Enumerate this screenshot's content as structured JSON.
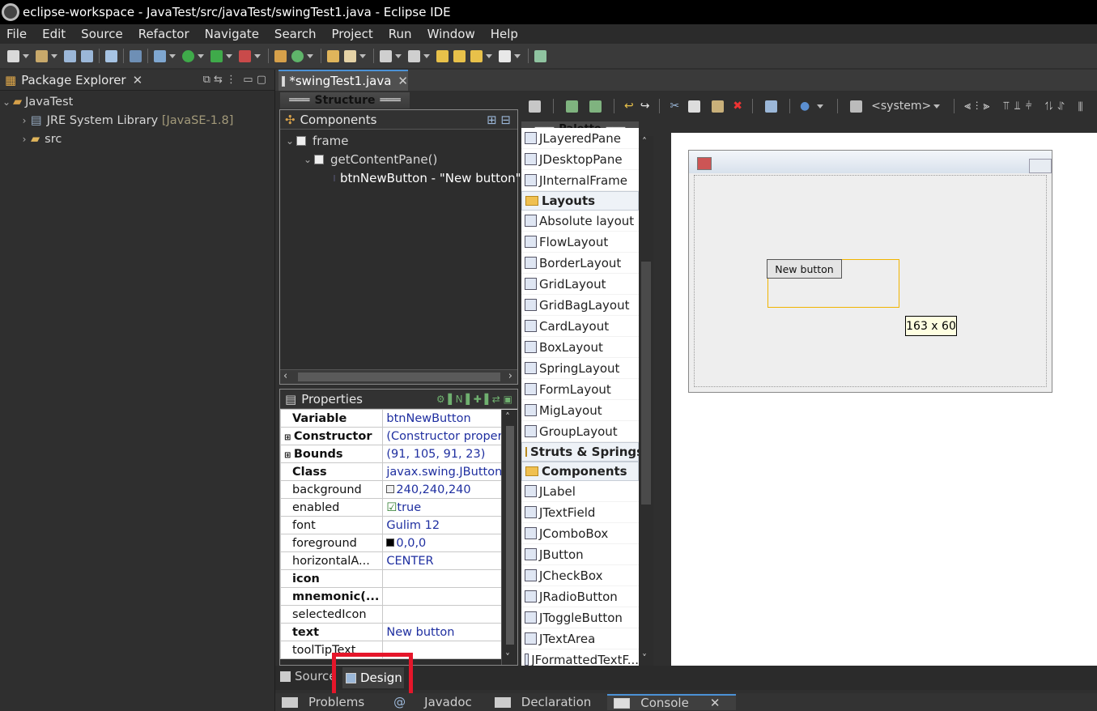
{
  "window": {
    "title": "eclipse-workspace - JavaTest/src/javaTest/swingTest1.java - Eclipse IDE"
  },
  "menu": [
    "File",
    "Edit",
    "Source",
    "Refactor",
    "Navigate",
    "Search",
    "Project",
    "Run",
    "Window",
    "Help"
  ],
  "package_explorer": {
    "title": "Package Explorer",
    "project": "JavaTest",
    "jre_label": "JRE System Library",
    "jre_version": "[JavaSE-1.8]",
    "src": "src"
  },
  "editor": {
    "tab_title": "*swingTest1.java"
  },
  "structure": {
    "title": "Structure",
    "components_title": "Components",
    "tree": [
      "frame",
      "getContentPane()",
      "btnNewButton - \"New button\""
    ]
  },
  "properties": {
    "title": "Properties",
    "rows": [
      {
        "key": "Variable",
        "value": "btnNewButton",
        "bold": true
      },
      {
        "key": "Constructor",
        "value": "(Constructor properti...",
        "bold": true,
        "expand": true
      },
      {
        "key": "Bounds",
        "value": "(91, 105, 91, 23)",
        "bold": true,
        "expand": true
      },
      {
        "key": "Class",
        "value": "javax.swing.JButton",
        "bold": true,
        "link": true
      },
      {
        "key": "background",
        "value": "240,240,240",
        "swatch": "#f0f0f0",
        "dots": true
      },
      {
        "key": "enabled",
        "value": "true",
        "check": true
      },
      {
        "key": "font",
        "value": "Gulim 12",
        "dots": true
      },
      {
        "key": "foreground",
        "value": "0,0,0",
        "swatch": "#000000",
        "dots": true
      },
      {
        "key": "horizontalA...",
        "value": "CENTER"
      },
      {
        "key": "icon",
        "value": "",
        "bold": true,
        "dots": true
      },
      {
        "key": "mnemonic(...",
        "value": "",
        "bold": true
      },
      {
        "key": "selectedIcon",
        "value": "",
        "dots": true
      },
      {
        "key": "text",
        "value": "New button",
        "bold": true,
        "dots": true
      },
      {
        "key": "toolTipText",
        "value": "",
        "dots": true
      }
    ]
  },
  "palette": {
    "title": "Palette",
    "items": [
      {
        "type": "item",
        "label": "JLayeredPane"
      },
      {
        "type": "item",
        "label": "JDesktopPane"
      },
      {
        "type": "item",
        "label": "JInternalFrame"
      },
      {
        "type": "cat",
        "label": "Layouts"
      },
      {
        "type": "item",
        "label": "Absolute layout"
      },
      {
        "type": "item",
        "label": "FlowLayout"
      },
      {
        "type": "item",
        "label": "BorderLayout"
      },
      {
        "type": "item",
        "label": "GridLayout"
      },
      {
        "type": "item",
        "label": "GridBagLayout"
      },
      {
        "type": "item",
        "label": "CardLayout"
      },
      {
        "type": "item",
        "label": "BoxLayout"
      },
      {
        "type": "item",
        "label": "SpringLayout"
      },
      {
        "type": "item",
        "label": "FormLayout"
      },
      {
        "type": "item",
        "label": "MigLayout"
      },
      {
        "type": "item",
        "label": "GroupLayout"
      },
      {
        "type": "cat",
        "label": "Struts & Springs"
      },
      {
        "type": "cat",
        "label": "Components"
      },
      {
        "type": "item",
        "label": "JLabel"
      },
      {
        "type": "item",
        "label": "JTextField"
      },
      {
        "type": "item",
        "label": "JComboBox"
      },
      {
        "type": "item",
        "label": "JButton"
      },
      {
        "type": "item",
        "label": "JCheckBox"
      },
      {
        "type": "item",
        "label": "JRadioButton"
      },
      {
        "type": "item",
        "label": "JToggleButton"
      },
      {
        "type": "item",
        "label": "JTextArea"
      },
      {
        "type": "item",
        "label": "JFormattedTextF..."
      }
    ]
  },
  "design_toolbar": {
    "lookandfeel": "<system>"
  },
  "canvas": {
    "button_text": "New button",
    "size_tooltip": "163 x 60"
  },
  "bottom": {
    "source_tab": "Source",
    "design_tab": "Design",
    "views": [
      "Problems",
      "Javadoc",
      "Declaration",
      "Console"
    ]
  },
  "colors": {
    "accent": "#4b91d6",
    "highlight": "#e5162a"
  }
}
